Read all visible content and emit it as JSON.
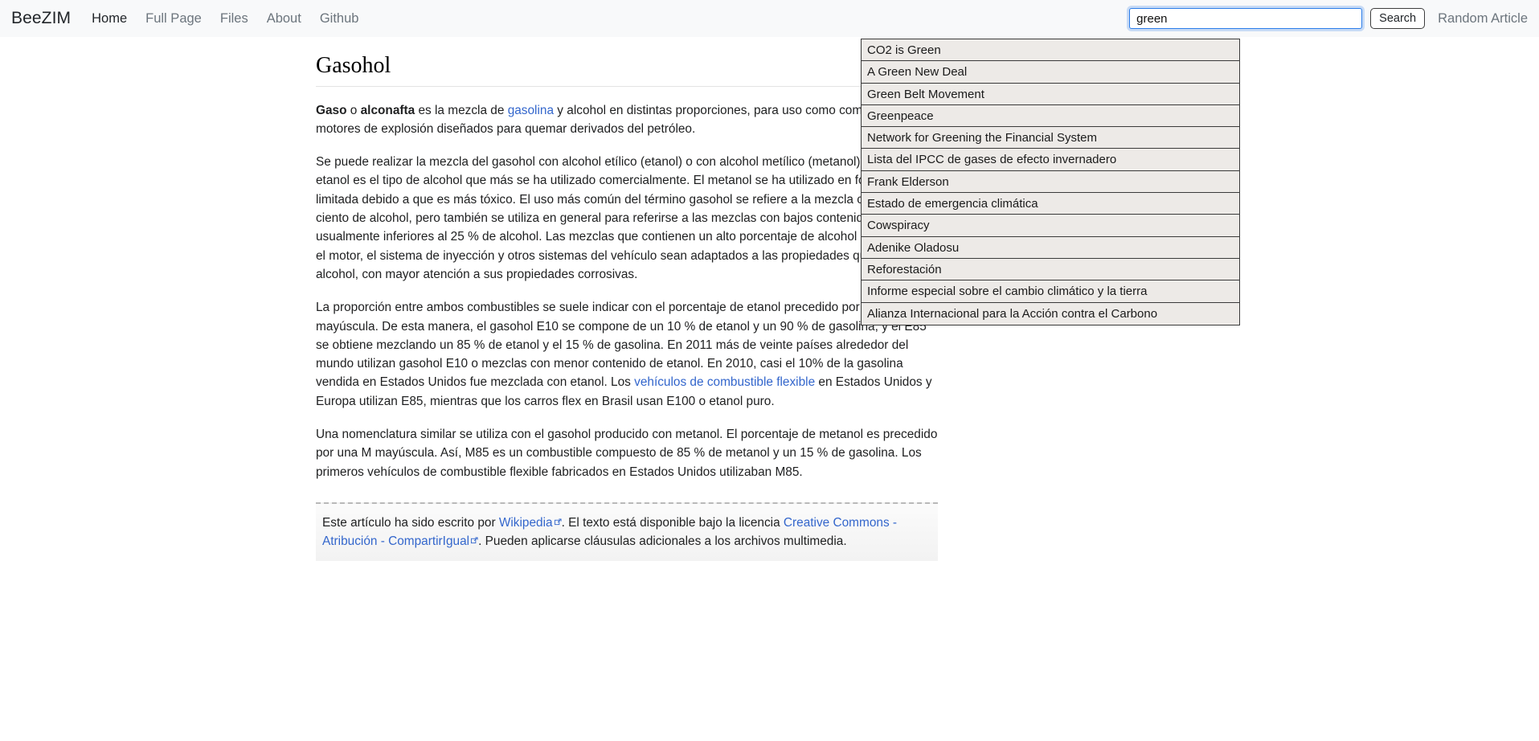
{
  "navbar": {
    "brand": "BeeZIM",
    "links": [
      {
        "label": "Home",
        "active": true
      },
      {
        "label": "Full Page",
        "active": false
      },
      {
        "label": "Files",
        "active": false
      },
      {
        "label": "About",
        "active": false
      },
      {
        "label": "Github",
        "active": false
      }
    ],
    "search": {
      "value": "green",
      "placeholder": "Search",
      "button_label": "Search"
    },
    "random_article_label": "Random Article"
  },
  "suggestions": [
    "CO2 is Green",
    "A Green New Deal",
    "Green Belt Movement",
    "Greenpeace",
    "Network for Greening the Financial System",
    "Lista del IPCC de gases de efecto invernadero",
    "Frank Elderson",
    "Estado de emergencia climática",
    "Cowspiracy",
    "Adenike Oladosu",
    "Reforestación",
    "Informe especial sobre el cambio climático y la tierra",
    "Alianza Internacional para la Acción contra el Carbono"
  ],
  "article": {
    "title": "Gasohol",
    "p1": {
      "bold1": "Gaso",
      "mid1": " o ",
      "bold2": "alconafta",
      "mid2": " es la mezcla de ",
      "link_gasolina": "gasolina",
      "rest": " y alcohol en distintas proporciones, para uso como combustible en motores de explosión diseñados para quemar derivados del petróleo."
    },
    "p2": "Se puede realizar la mezcla del gasohol con alcohol etílico (etanol) o con alcohol metílico (metanol), aunque el etanol es el tipo de alcohol que más se ha utilizado comercialmente. El metanol se ha utilizado en forma más limitada debido a que es más tóxico. El uso más común del término gasohol se refiere a la mezcla con el 10 por ciento de alcohol, pero también se utiliza en general para referirse a las mezclas con bajos contenidos de alcohol, usualmente inferiores al 25 % de alcohol. Las mezclas que contienen un alto porcentaje de alcohol requieren que el motor, el sistema de inyección y otros sistemas del vehículo sean adaptados a las propiedades químicas del alcohol, con mayor atención a sus propiedades corrosivas.",
    "p3": {
      "part1": "La proporción entre ambos combustibles se suele indicar con el porcentaje de etanol precedido por una E mayúscula. De esta manera, el gasohol E10 se compone de un 10 % de etanol y un 90 % de gasolina, y el E85 se obtiene mezclando un 85 % de etanol y el 15 % de gasolina. En 2011 más de veinte países alrededor del mundo utilizan gasohol E10 o mezclas con menor contenido de etanol. En 2010, casi el 10% de la gasolina vendida en Estados Unidos fue mezclada con etanol. Los ",
      "link_vehiculos": "vehículos de combustible flexible",
      "part2": " en Estados Unidos y Europa utilizan E85, mientras que los carros flex en Brasil usan E100 o etanol puro."
    },
    "p4": "Una nomenclatura similar se utiliza con el gasohol producido con metanol. El porcentaje de metanol es precedido por una M mayúscula. Así, M85 es un combustible compuesto de 85 % de metanol y un 15 % de gasolina. Los primeros vehículos de combustible flexible fabricados en Estados Unidos utilizaban M85."
  },
  "attribution": {
    "text_before_wikipedia": "Este artículo ha sido escrito por ",
    "wikipedia_label": "Wikipedia",
    "text_middle": ". El texto está disponible bajo la licencia ",
    "license_label": "Creative Commons - Atribución - CompartirIgual",
    "text_after": ". Pueden aplicarse cláusulas adicionales a los archivos multimedia."
  },
  "colors": {
    "navbar_bg": "#f8f9fa",
    "link_blue": "#3366cc",
    "focus_blue": "#2b7de9",
    "suggestion_bg": "#edeae7",
    "muted_text": "#6c757d"
  }
}
